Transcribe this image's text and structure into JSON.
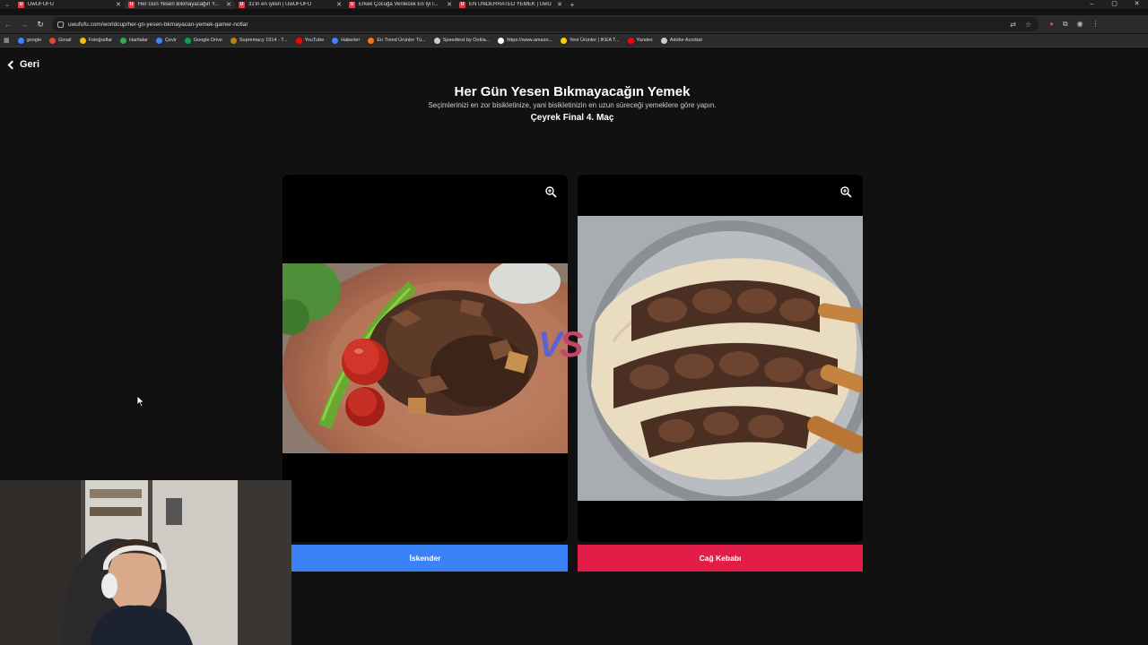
{
  "browser": {
    "tabs": [
      {
        "title": "UwUFUFU",
        "active": false
      },
      {
        "title": "Her Gün Yesen Bıkmayacağın Y...",
        "active": true
      },
      {
        "title": "31'in en iyileri | UwUFUFU",
        "active": false
      },
      {
        "title": "Erkek Çocuğa Verilecek En İyi İ...",
        "active": false
      },
      {
        "title": "EN UNDERRATED YEMEK | UwU...",
        "active": false
      }
    ],
    "url": "uwufufu.com/worldcup/her-gn-yesen-bkmayacan-yemek-gamer-notlar",
    "bookmarks": [
      {
        "label": "google",
        "color": "#4285f4"
      },
      {
        "label": "Gmail",
        "color": "#ea4335"
      },
      {
        "label": "Fotoğraflar",
        "color": "#fbbc05"
      },
      {
        "label": "Haritalar",
        "color": "#34a853"
      },
      {
        "label": "Çevir",
        "color": "#4285f4"
      },
      {
        "label": "Google Drive",
        "color": "#0f9d58"
      },
      {
        "label": "Supremacy 1914 - T...",
        "color": "#b8860b"
      },
      {
        "label": "YouTube",
        "color": "#ff0000"
      },
      {
        "label": "Haberler",
        "color": "#4285f4"
      },
      {
        "label": "En Trend Ürünler Tü...",
        "color": "#f57224"
      },
      {
        "label": "Speedtest by Ookla...",
        "color": "#cccccc"
      },
      {
        "label": "https://www.amazo...",
        "color": "#ffffff"
      },
      {
        "label": "Yeni Ürünler | IKEA T...",
        "color": "#ffcc00"
      },
      {
        "label": "Yandex",
        "color": "#ff0000"
      },
      {
        "label": "Adobe Acrobat",
        "color": "#cccccc"
      }
    ]
  },
  "page": {
    "back_label": "Geri",
    "title": "Her Gün Yesen Bıkmayacağın Yemek",
    "subtitle": "Seçimlerinizi en zor bisikletinize, yani bisikletinizin en uzun süreceği yemeklere göre yapın.",
    "round": "Çeyrek Final 4. Maç",
    "vs": {
      "v": "V",
      "s": "S"
    }
  },
  "choices": {
    "left": {
      "label": "İskender",
      "color": "#3b82f6"
    },
    "right": {
      "label": "Cağ Kebabı",
      "color": "#e11d48"
    }
  }
}
